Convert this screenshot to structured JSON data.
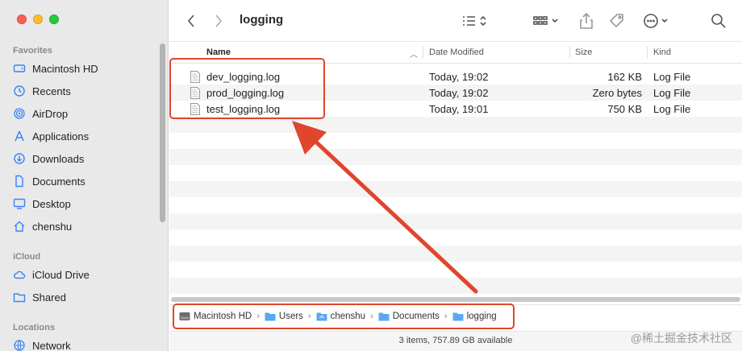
{
  "window": {
    "title": "logging"
  },
  "sidebar": {
    "favorites_label": "Favorites",
    "favorites": [
      {
        "label": "Macintosh HD",
        "icon": "harddisk-icon"
      },
      {
        "label": "Recents",
        "icon": "clock-icon"
      },
      {
        "label": "AirDrop",
        "icon": "airdrop-icon"
      },
      {
        "label": "Applications",
        "icon": "applications-icon"
      },
      {
        "label": "Downloads",
        "icon": "download-icon"
      },
      {
        "label": "Documents",
        "icon": "document-icon"
      },
      {
        "label": "Desktop",
        "icon": "desktop-icon"
      },
      {
        "label": "chenshu",
        "icon": "home-icon"
      }
    ],
    "icloud_label": "iCloud",
    "icloud": [
      {
        "label": "iCloud Drive",
        "icon": "cloud-icon"
      },
      {
        "label": "Shared",
        "icon": "shared-folder-icon"
      }
    ],
    "locations_label": "Locations",
    "locations": [
      {
        "label": "Network",
        "icon": "globe-icon"
      }
    ]
  },
  "columns": {
    "name": "Name",
    "date": "Date Modified",
    "size": "Size",
    "kind": "Kind"
  },
  "files": [
    {
      "name": "dev_logging.log",
      "date": "Today, 19:02",
      "size": "162 KB",
      "kind": "Log File"
    },
    {
      "name": "prod_logging.log",
      "date": "Today, 19:02",
      "size": "Zero bytes",
      "kind": "Log File"
    },
    {
      "name": "test_logging.log",
      "date": "Today, 19:01",
      "size": "750 KB",
      "kind": "Log File"
    }
  ],
  "path": [
    "Macintosh HD",
    "Users",
    "chenshu",
    "Documents",
    "logging"
  ],
  "status": "3 items, 757.89 GB available",
  "watermark": "@稀土掘金技术社区",
  "colors": {
    "annotation": "#e0452d",
    "accent": "#3b82f6"
  }
}
